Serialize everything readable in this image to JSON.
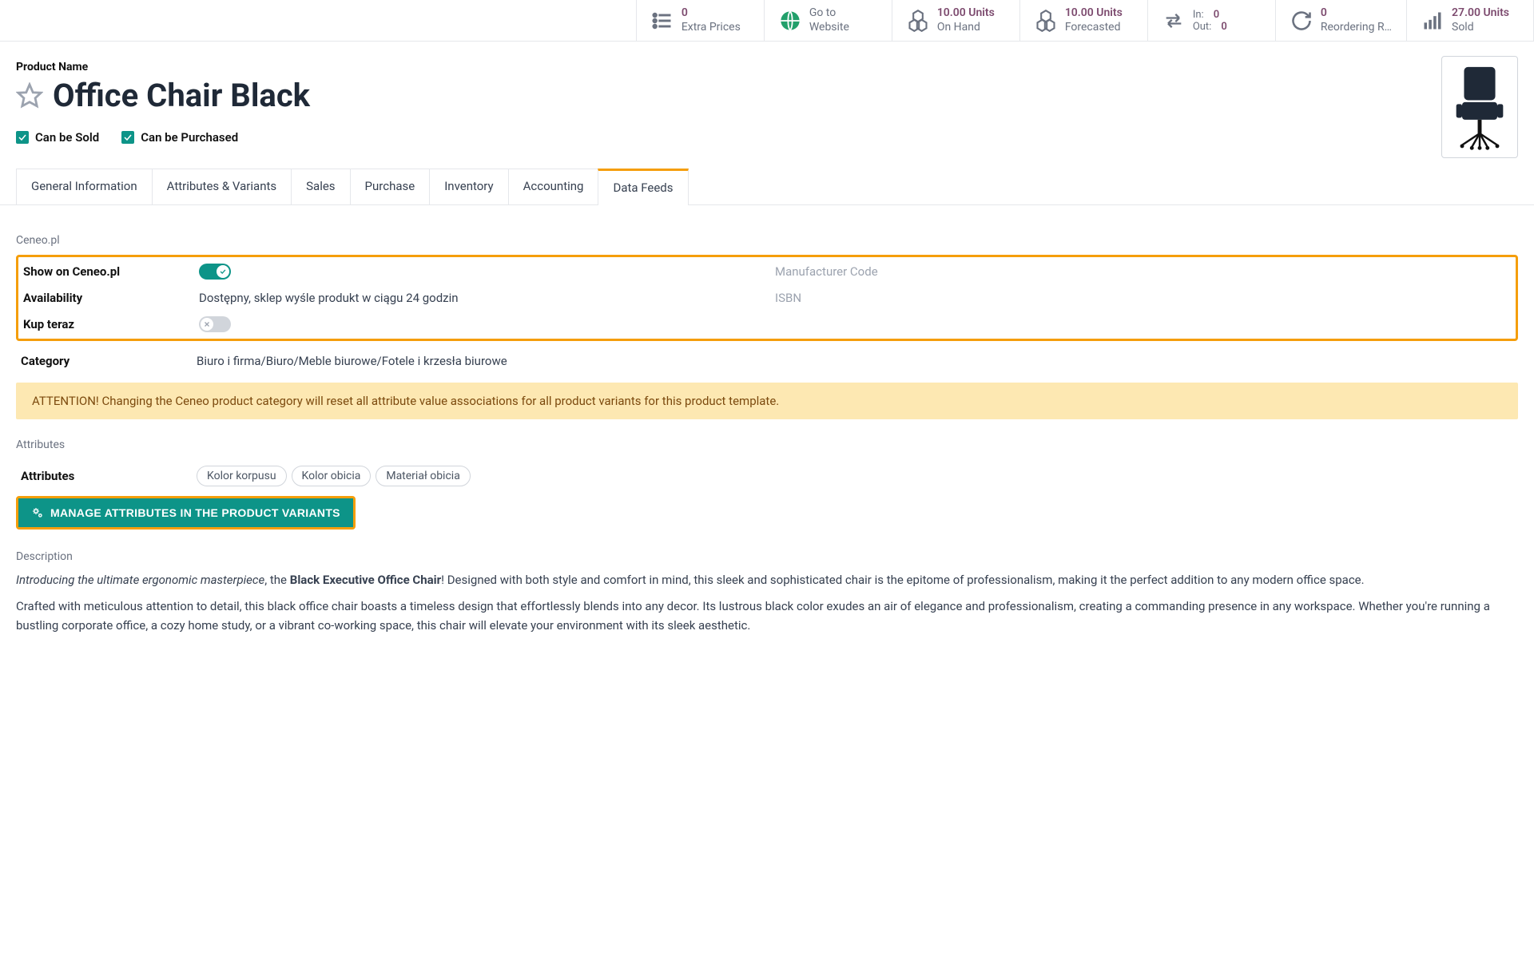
{
  "stats": {
    "extra_prices": {
      "value": "0",
      "label": "Extra Prices"
    },
    "website": {
      "label1": "Go to",
      "label2": "Website"
    },
    "on_hand": {
      "value": "10.00 Units",
      "label": "On Hand"
    },
    "forecasted": {
      "value": "10.00 Units",
      "label": "Forecasted"
    },
    "inout": {
      "in_k": "In:",
      "in_v": "0",
      "out_k": "Out:",
      "out_v": "0"
    },
    "reorder": {
      "value": "0",
      "label": "Reordering R…"
    },
    "sold": {
      "value": "27.00 Units",
      "label": "Sold"
    }
  },
  "header": {
    "field_label": "Product Name",
    "title": "Office Chair Black",
    "can_be_sold": "Can be Sold",
    "can_be_purchased": "Can be Purchased"
  },
  "tabs": [
    "General Information",
    "Attributes & Variants",
    "Sales",
    "Purchase",
    "Inventory",
    "Accounting",
    "Data Feeds"
  ],
  "active_tab": 6,
  "ceneo": {
    "section": "Ceneo.pl",
    "show_label": "Show on Ceneo.pl",
    "show_on": true,
    "availability_label": "Availability",
    "availability_value": "Dostępny, sklep wyśle produkt w ciągu 24 godzin",
    "kup_label": "Kup teraz",
    "kup_on": false,
    "mfr_label": "Manufacturer Code",
    "isbn_label": "ISBN",
    "category_label": "Category",
    "category_value": "Biuro i firma/Biuro/Meble biurowe/Fotele i krzesła biurowe",
    "alert": "ATTENTION! Changing the Ceneo product category will reset all attribute value associations for all product variants for this product template."
  },
  "attributes": {
    "section": "Attributes",
    "label": "Attributes",
    "tags": [
      "Kolor korpusu",
      "Kolor obicia",
      "Materiał obicia"
    ],
    "manage_btn": "MANAGE ATTRIBUTES IN THE PRODUCT VARIANTS"
  },
  "description": {
    "section": "Description",
    "p1_lead": "Introducing the ultimate ergonomic masterpiece",
    "p1_mid": ", the ",
    "p1_bold": "Black Executive Office Chair",
    "p1_rest": "! Designed with both style and comfort in mind, this sleek and sophisticated chair is the epitome of professionalism, making it the perfect addition to any modern office space.",
    "p2": "Crafted with meticulous attention to detail, this black office chair boasts a timeless design that effortlessly blends into any decor. Its lustrous black color exudes an air of elegance and professionalism, creating a commanding presence in any workspace. Whether you're running a bustling corporate office, a cozy home study, or a vibrant co-working space, this chair will elevate your environment with its sleek aesthetic."
  }
}
